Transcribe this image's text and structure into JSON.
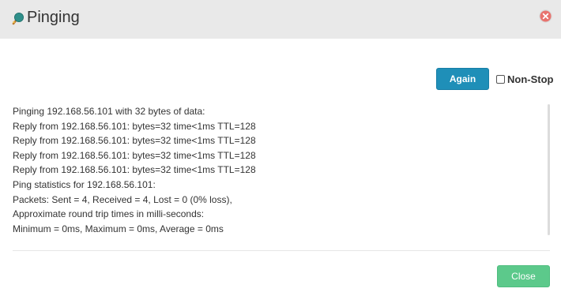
{
  "dialog": {
    "title": "Pinging",
    "title_icon": "ping-pong-paddle-icon",
    "close_icon": "close-circle-icon"
  },
  "controls": {
    "again_label": "Again",
    "nonstop_label": "Non-Stop",
    "nonstop_checked": false
  },
  "output": {
    "lines": [
      "Pinging 192.168.56.101 with 32 bytes of data:",
      "Reply from 192.168.56.101: bytes=32 time<1ms TTL=128",
      "Reply from 192.168.56.101: bytes=32 time<1ms TTL=128",
      "Reply from 192.168.56.101: bytes=32 time<1ms TTL=128",
      "Reply from 192.168.56.101: bytes=32 time<1ms TTL=128",
      "Ping statistics for 192.168.56.101:",
      "Packets: Sent = 4, Received = 4, Lost = 0 (0% loss),",
      "Approximate round trip times in milli-seconds:",
      "Minimum = 0ms, Maximum = 0ms, Average = 0ms"
    ]
  },
  "footer": {
    "close_label": "Close"
  },
  "colors": {
    "titlebar": "#e9e9e9",
    "again_button": "#1f8fb8",
    "close_button": "#5cc98b",
    "close_icon": "#e8736e"
  }
}
